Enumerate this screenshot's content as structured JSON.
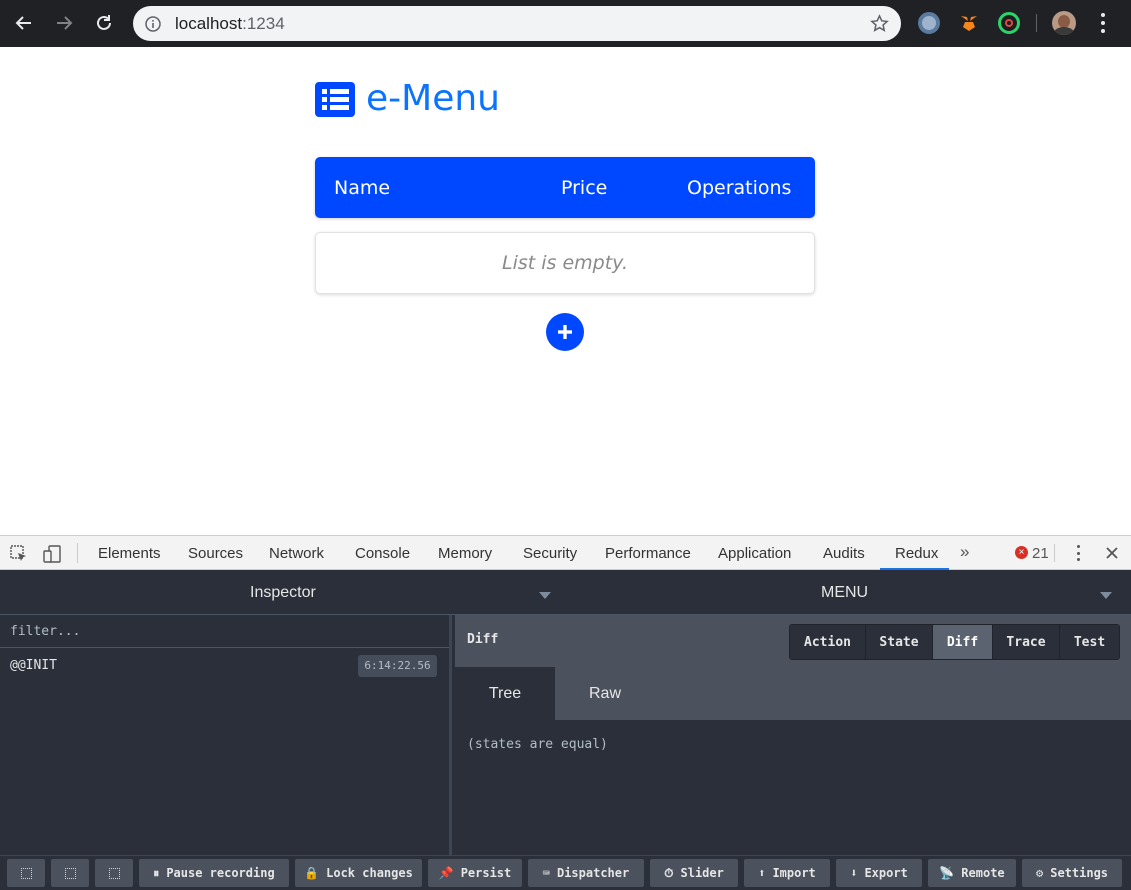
{
  "browser": {
    "url_host": "localhost",
    "url_port": ":1234"
  },
  "app": {
    "title": "e-Menu",
    "columns": [
      "Name",
      "Price",
      "Operations"
    ],
    "empty_text": "List is empty.",
    "colors": {
      "primary": "#0048ff",
      "title": "#0a73ff"
    }
  },
  "devtools": {
    "tabs": [
      "Elements",
      "Sources",
      "Network",
      "Console",
      "Memory",
      "Security",
      "Performance",
      "Application",
      "Audits",
      "Redux"
    ],
    "active_tab": "Redux",
    "more": "»",
    "error_count": "21",
    "error_icon": "×"
  },
  "redux": {
    "monitor": "Inspector",
    "instance": "MENU",
    "filter_placeholder": "filter...",
    "actions": [
      {
        "name": "@@INIT",
        "time": "6:14:22.56"
      }
    ],
    "panel_title": "Diff",
    "segments": [
      "Action",
      "State",
      "Diff",
      "Trace",
      "Test"
    ],
    "active_segment": "Diff",
    "subtabs": [
      "Tree",
      "Raw"
    ],
    "active_subtab": "Tree",
    "diff_message": "(states are equal)",
    "footer": {
      "pause": "Pause recording",
      "lock": "Lock changes",
      "persist": "Persist",
      "dispatcher": "Dispatcher",
      "slider": "Slider",
      "import": "Import",
      "export": "Export",
      "remote": "Remote",
      "settings": "Settings"
    }
  }
}
